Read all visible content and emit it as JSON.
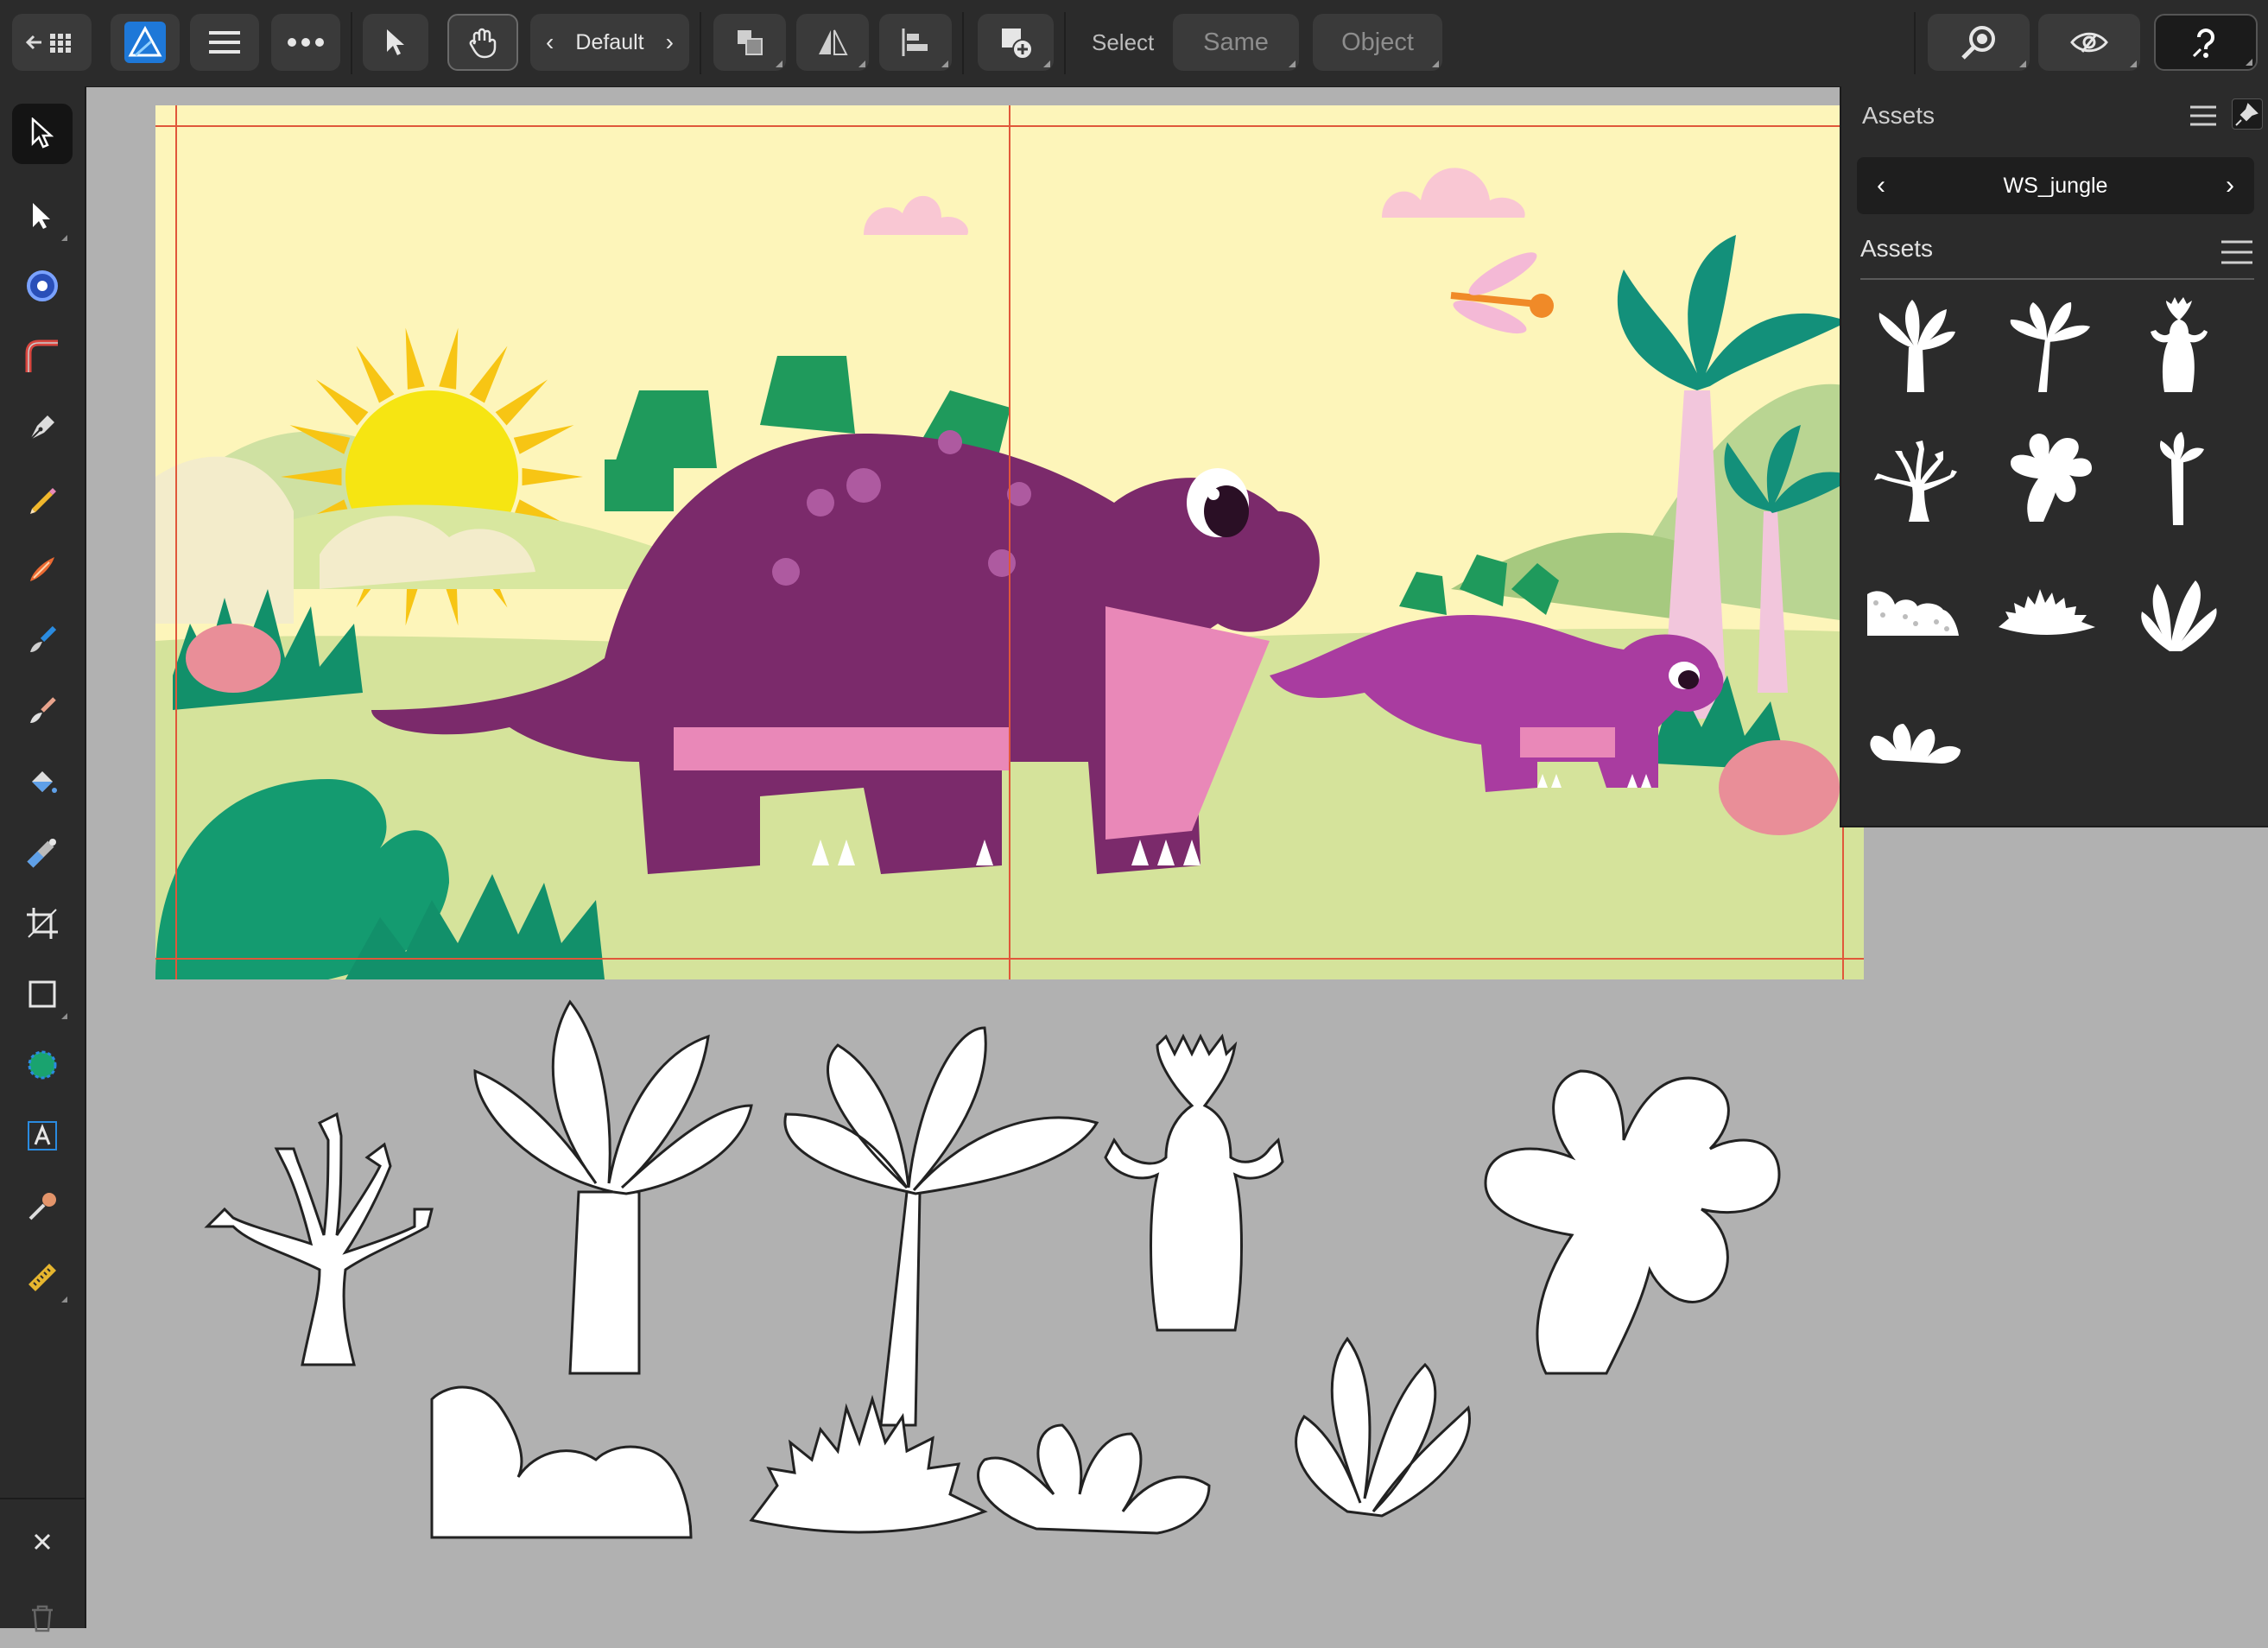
{
  "app": {
    "name": "Affinity Designer",
    "preset": "Default"
  },
  "toolbar": {
    "select_label": "Select",
    "same_label": "Same",
    "object_label": "Object"
  },
  "assets_panel": {
    "title": "Assets",
    "category": "WS_jungle",
    "section_title": "Assets",
    "items": [
      "palm-tree-icon",
      "fan-palm-icon",
      "baobab-tree-icon",
      "bare-tree-icon",
      "round-leaf-tree-icon",
      "thin-palm-icon",
      "dotted-bush-icon",
      "spiky-bush-icon",
      "leafy-plant-icon",
      "shrub-icon"
    ]
  },
  "colors": {
    "ui_dark": "#2b2b2b",
    "ui_button": "#3a3a3a",
    "canvas_grey": "#b1b1b1",
    "artboard_sky": "#fdf5ba",
    "grass": "#d3e39a",
    "dino_purple": "#7b2a6b",
    "dino_pink": "#e988b8",
    "leaf_green": "#159a6c",
    "sun_yellow": "#f6d412",
    "guide_red": "#e0573a",
    "affinity_blue": "#1e78d8"
  },
  "left_tools": [
    "move-tool-icon",
    "node-tool-icon",
    "color-picker-icon",
    "corner-tool-icon",
    "pen-tool-icon",
    "pencil-tool-icon",
    "vector-brush-icon",
    "paint-brush-icon",
    "pixel-brush-icon",
    "fill-tool-icon",
    "transparency-tool-icon",
    "crop-tool-icon",
    "rectangle-tool-icon",
    "shape-builder-icon",
    "artistic-text-icon",
    "eyedropper-icon",
    "measure-tool-icon"
  ]
}
